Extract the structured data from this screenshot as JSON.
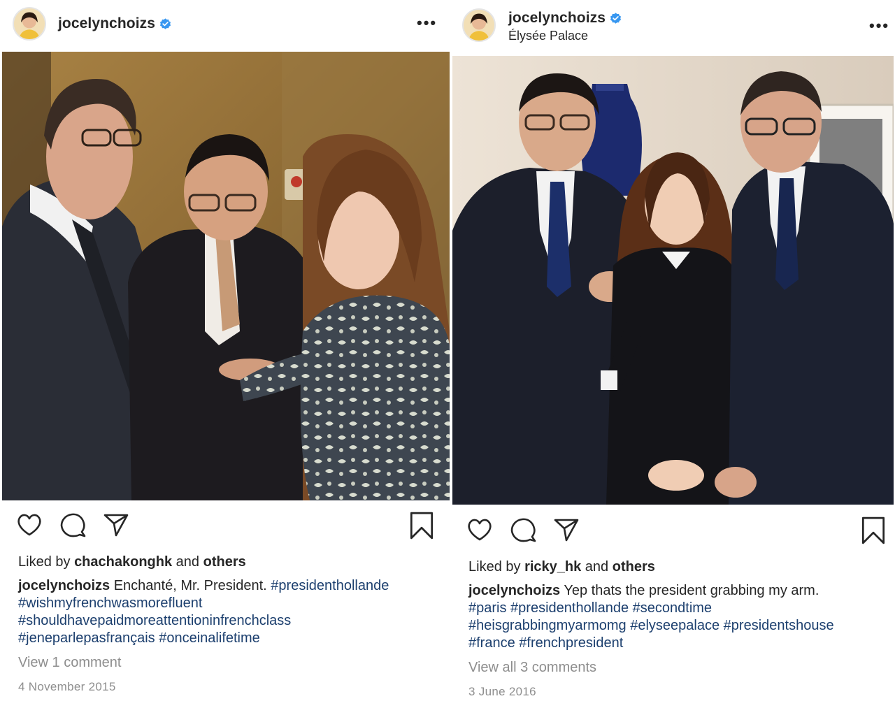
{
  "posts": [
    {
      "username": "jocelynchoizs",
      "location": "",
      "more": "•••",
      "liked_by_prefix": "Liked by",
      "liked_by_user": "chachakonghk",
      "liked_by_and": "and",
      "liked_by_others": "others",
      "caption_user": "jocelynchoizs",
      "caption_text": "Enchanté, Mr. President.",
      "hashtags": [
        "#presidenthollande",
        "#wishmyfrenchwasmorefluent",
        "#shouldhavepaidmoreattentioninfrenchclass",
        "#jeneparlepasfrançais",
        "#onceinalifetime"
      ],
      "comments_link": "View 1 comment",
      "date": "4 November 2015",
      "icons": [
        "heart-icon",
        "comment-icon",
        "share-icon",
        "bookmark-icon"
      ]
    },
    {
      "username": "jocelynchoizs",
      "location": "Élysée Palace",
      "more": "•••",
      "liked_by_prefix": "Liked by",
      "liked_by_user": "ricky_hk",
      "liked_by_and": "and",
      "liked_by_others": "others",
      "caption_user": "jocelynchoizs",
      "caption_text": "Yep thats the president grabbing my arm.",
      "hashtags": [
        "#paris",
        "#presidenthollande",
        "#secondtime",
        "#heisgrabbingmyarmomg",
        "#elyseepalace",
        "#presidentshouse",
        "#france",
        "#frenchpresident"
      ],
      "comments_link": "View all 3 comments",
      "date": "3 June 2016",
      "icons": [
        "heart-icon",
        "comment-icon",
        "share-icon",
        "bookmark-icon"
      ]
    }
  ],
  "colors": {
    "text": "#262626",
    "muted": "#8e8e8e",
    "hashtag": "#1c3f6e",
    "verified": "#3897f0"
  }
}
